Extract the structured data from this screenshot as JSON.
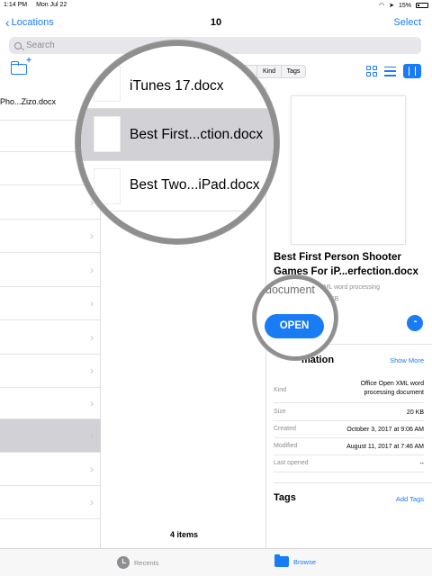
{
  "status_bar": {
    "time": "1:14 PM",
    "date": "Mon Jul 22",
    "battery": "15%"
  },
  "nav": {
    "back_label": "Locations",
    "title": "10",
    "select_label": "Select"
  },
  "search": {
    "placeholder": "Search"
  },
  "toolbar": {
    "segments": [
      "Kind",
      "Tags"
    ]
  },
  "column1": {
    "first_item": "Pho...Zizo.docx"
  },
  "column2": {
    "items": [
      "iTunes 17.docx",
      "Best First...ction.docx",
      "Best Two...iPad.docx"
    ],
    "count_label": "4 items"
  },
  "detail": {
    "title": "Best First Person Shooter Games For iP...erfection.docx",
    "subtitle_kind": "document",
    "subtitle": "XML word processing",
    "size_short": "KB",
    "open_label": "OPEN",
    "more_label": "•••",
    "info_heading": "mation",
    "show_more": "Show More",
    "info": [
      {
        "key": "Kind",
        "value": "Office Open XML word processing document"
      },
      {
        "key": "Size",
        "value": "20 KB"
      },
      {
        "key": "Created",
        "value": "October 3, 2017 at 9:06 AM"
      },
      {
        "key": "Modified",
        "value": "August 11, 2017 at 7:46 AM"
      },
      {
        "key": "Last opened",
        "value": "--"
      }
    ],
    "tags_heading": "Tags",
    "add_tags": "Add Tags"
  },
  "tab_bar": {
    "recents_label": "Recents",
    "browse_label": "Browse"
  },
  "colors": {
    "accent": "#1a7cf5",
    "selected_row": "#d1d1d6"
  }
}
